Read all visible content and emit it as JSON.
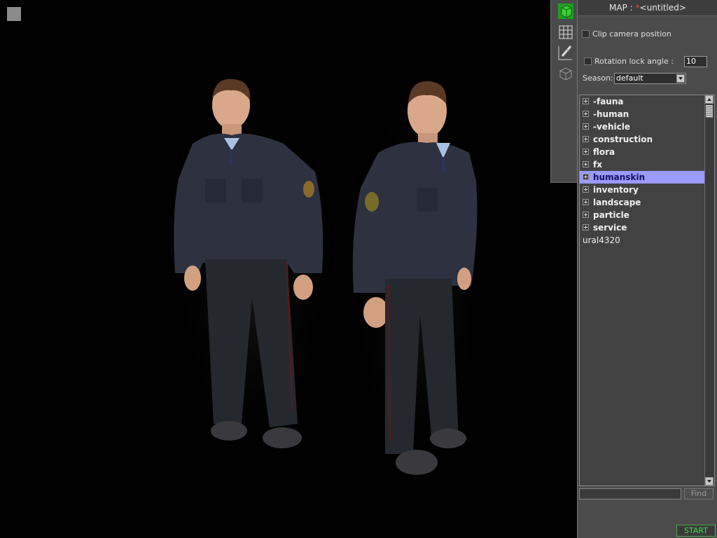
{
  "map": {
    "label": "MAP :",
    "modified_marker": "*",
    "name": "<untitled>"
  },
  "options": {
    "clip_camera_label": "Clip camera position",
    "clip_camera_checked": false,
    "rotation_lock_label": "Rotation lock angle :",
    "rotation_lock_checked": false,
    "rotation_lock_value": "10",
    "season_label": "Season:",
    "season_value": "default"
  },
  "tree": {
    "items": [
      {
        "label": "-fauna",
        "expandable": true,
        "selected": false
      },
      {
        "label": "-human",
        "expandable": true,
        "selected": false
      },
      {
        "label": "-vehicle",
        "expandable": true,
        "selected": false
      },
      {
        "label": "construction",
        "expandable": true,
        "selected": false
      },
      {
        "label": "flora",
        "expandable": true,
        "selected": false
      },
      {
        "label": "fx",
        "expandable": true,
        "selected": false
      },
      {
        "label": "humanskin",
        "expandable": true,
        "selected": true
      },
      {
        "label": "inventory",
        "expandable": true,
        "selected": false
      },
      {
        "label": "landscape",
        "expandable": true,
        "selected": false
      },
      {
        "label": "particle",
        "expandable": true,
        "selected": false
      },
      {
        "label": "service",
        "expandable": true,
        "selected": false
      },
      {
        "label": "ural4320",
        "expandable": false,
        "selected": false
      }
    ]
  },
  "search": {
    "find_label": "Find",
    "value": ""
  },
  "start_label": "START",
  "toolbar": {
    "tools": [
      "cube-green-icon",
      "grid-icon",
      "ruler-pencil-icon",
      "wireframe-cube-icon"
    ]
  },
  "colors": {
    "selection": "#9a9aff",
    "start_text": "#3fe03f",
    "modified_marker": "#ff3b3b",
    "active_tool": "#1fa01f"
  }
}
